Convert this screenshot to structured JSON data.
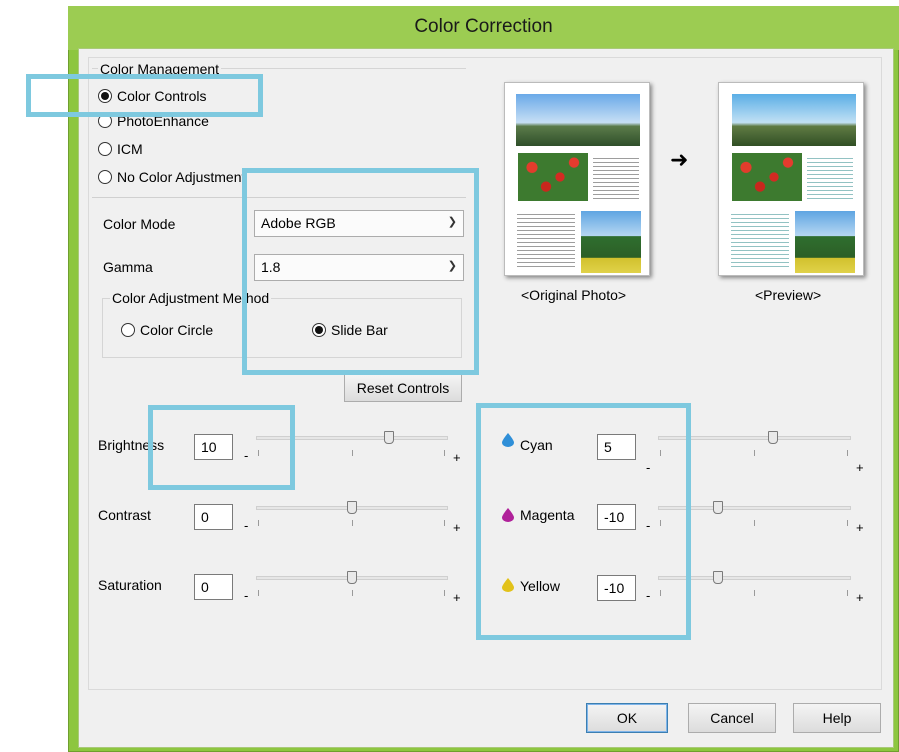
{
  "window": {
    "title": "Color Correction"
  },
  "color_management": {
    "label": "Color Management",
    "options": [
      {
        "label": "Color Controls",
        "selected": true
      },
      {
        "label": "PhotoEnhance",
        "selected": false
      },
      {
        "label": "ICM",
        "selected": false
      },
      {
        "label": "No Color Adjustment",
        "selected": false
      }
    ]
  },
  "color_mode": {
    "label": "Color Mode",
    "value": "Adobe RGB"
  },
  "gamma": {
    "label": "Gamma",
    "value": "1.8"
  },
  "adjustment_method": {
    "label": "Color Adjustment Method",
    "options": [
      {
        "label": "Color Circle",
        "selected": false
      },
      {
        "label": "Slide Bar",
        "selected": true
      }
    ]
  },
  "reset_label": "Reset Controls",
  "preview": {
    "original_label": "<Original Photo>",
    "preview_label": "<Preview>"
  },
  "sliders_left": [
    {
      "label": "Brightness",
      "value": "10"
    },
    {
      "label": "Contrast",
      "value": "0"
    },
    {
      "label": "Saturation",
      "value": "0"
    }
  ],
  "sliders_right": [
    {
      "label": "Cyan",
      "value": "5",
      "color": "#2f8fd8"
    },
    {
      "label": "Magenta",
      "value": "-10",
      "color": "#b0219a"
    },
    {
      "label": "Yellow",
      "value": "-10",
      "color": "#e2c21a"
    }
  ],
  "slider_symbols": {
    "minus": "-",
    "plus": "+"
  },
  "buttons": {
    "ok": "OK",
    "cancel": "Cancel",
    "help": "Help"
  },
  "highlight_color": "#7ec9df"
}
